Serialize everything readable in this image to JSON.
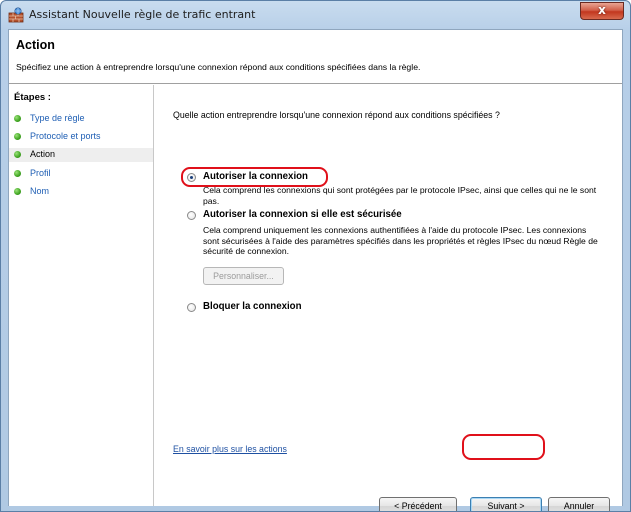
{
  "window": {
    "title": "Assistant Nouvelle règle de trafic entrant",
    "close_glyph": "x"
  },
  "header": {
    "title": "Action",
    "description": "Spécifiez une action à entreprendre lorsqu'une connexion répond aux conditions spécifiées dans la règle."
  },
  "sidebar": {
    "title": "Étapes :",
    "steps": [
      {
        "label": "Type de règle",
        "current": false
      },
      {
        "label": "Protocole et ports",
        "current": false
      },
      {
        "label": "Action",
        "current": true
      },
      {
        "label": "Profil",
        "current": false
      },
      {
        "label": "Nom",
        "current": false
      }
    ]
  },
  "main": {
    "question": "Quelle action entreprendre lorsqu'une connexion répond aux conditions spécifiées ?",
    "options": [
      {
        "label": "Autoriser la connexion",
        "selected": true,
        "description": "Cela comprend les connexions qui sont protégées par le protocole IPsec, ainsi que celles qui ne le sont pas."
      },
      {
        "label": "Autoriser la connexion si elle est sécurisée",
        "selected": false,
        "description": "Cela comprend uniquement les connexions authentifiées à l'aide du protocole IPsec. Les connexions sont sécurisées à l'aide des paramètres spécifiés dans les propriétés et règles IPsec du nœud Règle de sécurité de connexion."
      },
      {
        "label": "Bloquer la connexion",
        "selected": false,
        "description": ""
      }
    ],
    "customize_button": "Personnaliser...",
    "learn_more_link": "En savoir plus sur les actions"
  },
  "footer": {
    "previous_button": "< Précédent",
    "next_button": "Suivant >",
    "cancel_button": "Annuler"
  },
  "colors": {
    "highlight": "#e0101a",
    "link": "#1e50a2",
    "step_bullet": "#3fa421"
  },
  "icons": {
    "title": "firewall-wall-icon",
    "step_bullet": "green-dot-icon"
  }
}
